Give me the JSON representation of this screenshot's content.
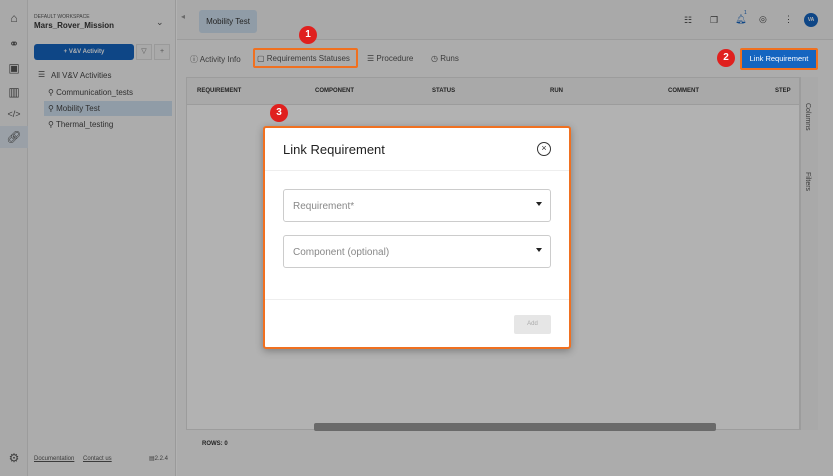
{
  "workspace": {
    "label": "DEFAULT WORKSPACE",
    "name": "Mars_Rover_Mission"
  },
  "sidebar": {
    "add_button": "+ V&V Activity",
    "all_label": "All V&V Activities",
    "items": [
      {
        "label": "Communication_tests"
      },
      {
        "label": "Mobility Test"
      },
      {
        "label": "Thermal_testing"
      }
    ],
    "footer": {
      "documentation": "Documentation",
      "contact": "Contact us",
      "version": "2.2.4"
    }
  },
  "header": {
    "tab": "Mobility Test",
    "notification_count": "1",
    "avatar": "VA"
  },
  "tabs": [
    {
      "label": "Activity Info"
    },
    {
      "label": "Requirements Statuses"
    },
    {
      "label": "Procedure"
    },
    {
      "label": "Runs"
    }
  ],
  "link_button": "Link Requirement",
  "table": {
    "columns": [
      "REQUIREMENT",
      "COMPONENT",
      "STATUS",
      "RUN",
      "COMMENT",
      "STEP"
    ],
    "rows_label": "ROWS: 0",
    "side_columns": "Columns",
    "side_filters": "Filters"
  },
  "modal": {
    "title": "Link Requirement",
    "requirement_placeholder": "Requirement*",
    "component_placeholder": "Component (optional)",
    "add": "Add"
  },
  "annotations": [
    "1",
    "2",
    "3"
  ],
  "colors": {
    "accent": "#1565c0",
    "highlight": "#f07020",
    "badge": "#e0201e"
  }
}
